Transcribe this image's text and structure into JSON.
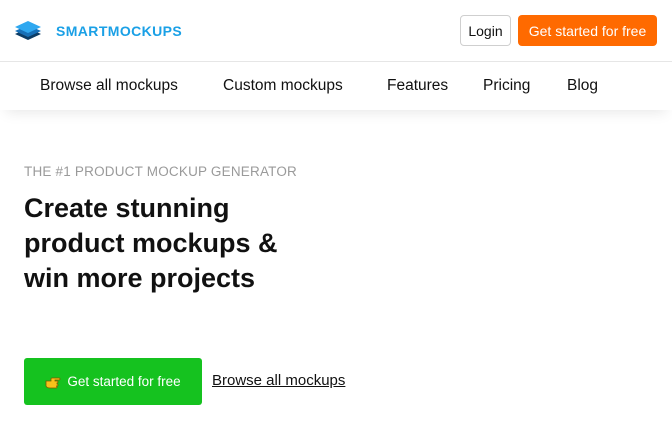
{
  "header": {
    "brand": {
      "name": "SMARTMOCKUPS",
      "logo_icon": "stacked-layers-icon",
      "brand_color": "#1aa0e6"
    },
    "login_label": "Login",
    "cta_label": "Get started for free",
    "cta_color": "#ff6a00"
  },
  "nav": {
    "items": [
      {
        "label": "Browse all mockups"
      },
      {
        "label": "Custom mockups"
      },
      {
        "label": "Features"
      },
      {
        "label": "Pricing"
      },
      {
        "label": "Blog"
      }
    ]
  },
  "hero": {
    "eyebrow": "THE #1 PRODUCT MOCKUP GENERATOR",
    "headline_lines": [
      "Create stunning",
      "product mockups &",
      "win more projects"
    ],
    "primary_cta": {
      "label": "Get started for free",
      "icon": "pointing-hand-icon",
      "color": "#15c21f"
    },
    "secondary_link": "Browse all mockups"
  }
}
